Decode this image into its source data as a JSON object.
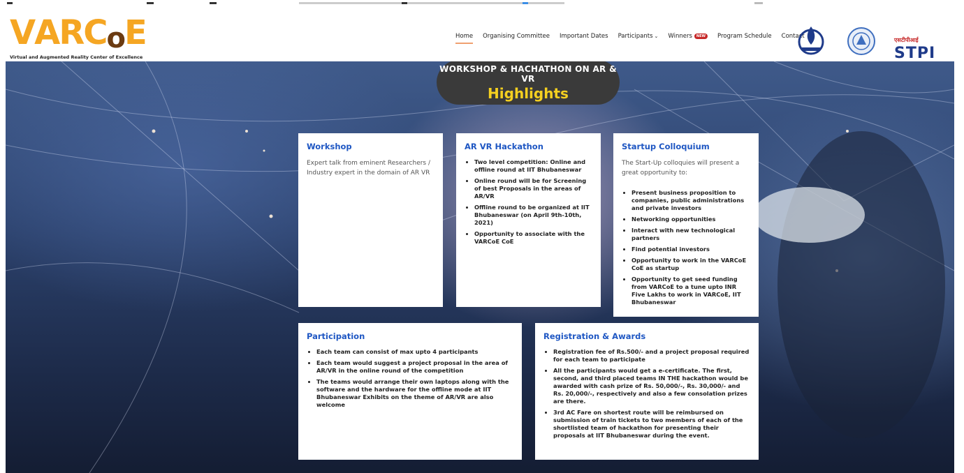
{
  "logo": {
    "letters": [
      "V",
      "A",
      "R",
      "C",
      "o",
      "E"
    ],
    "tagline": "Virtual and Augmented Reality Center of Excellence"
  },
  "nav": {
    "home": "Home",
    "committee": "Organising Committee",
    "dates": "Important Dates",
    "participants": "Participants",
    "winners": "Winners",
    "winners_badge": "NEW",
    "schedule": "Program Schedule",
    "contact": "Contact"
  },
  "partners": {
    "stpi_top": "एसटीपीआई",
    "stpi": "STPI"
  },
  "banner": {
    "line1": "WORKSHOP & HACHATHON ON AR & VR",
    "line2": "Highlights"
  },
  "workshop": {
    "title": "Workshop",
    "text": "Expert talk from eminent Researchers / Industry expert in the domain of AR VR"
  },
  "hackathon": {
    "title": "AR VR Hackathon",
    "items": [
      "Two level competition: Online and offline round at IIT Bhubaneswar",
      "Online round will be for Screening of best Proposals in the areas of AR/VR",
      "Offline round to be organized at IIT Bhubaneswar (on April 9th-10th, 2021)",
      "Opportunity to associate with the VARCoE CoE"
    ]
  },
  "startup": {
    "title": "Startup Colloquium",
    "intro": "The Start-Up colloquies will present a great opportunity to:",
    "items": [
      "Present business proposition to companies, public administrations and private investors",
      "Networking opportunities",
      "Interact with new technological partners",
      "Find potential investors",
      "Opportunity to work in the VARCoE CoE as startup",
      "Opportunity to get seed funding from VARCoE to a tune upto INR Five Lakhs to work in VARCoE, IIT Bhubaneswar"
    ]
  },
  "participation": {
    "title": "Participation",
    "item1_pre": "Each team can consist of max upto ",
    "item1_bold": "4 participants",
    "item2": "Each team would suggest a project proposal in the area of AR/VR in the online round of the competition",
    "item3": "The teams would arrange their own laptops along with the software and the hardware for the offline mode at IIT Bhubaneswar Exhibits on the theme of AR/VR are also welcome"
  },
  "registration": {
    "title": "Registration & Awards",
    "item1": "Registration fee of Rs.500/- and a project proposal required for each team to participate",
    "item2_pre": "All the participants would get a e-certificate. The first, second, and third placed teams IN THE hackathon would be awarded with cash ",
    "item2_bold": "prize of Rs. 50,000/-, Rs. 30,000/- and Rs. 20,000/-",
    "item2_post": ", respectively and also a few consolation prizes are there.",
    "item3": "3rd AC Fare on shortest route will be reimbursed on submission of train tickets to two members of each of the shortlisted team of hackathon for presenting their proposals at IIT Bhubaneswar during the event."
  },
  "colors": {
    "accent": "#1f57c3",
    "logo_orange": "#f5a623",
    "banner_yellow": "#f5d020",
    "banner_bg": "#3a3a3a"
  }
}
